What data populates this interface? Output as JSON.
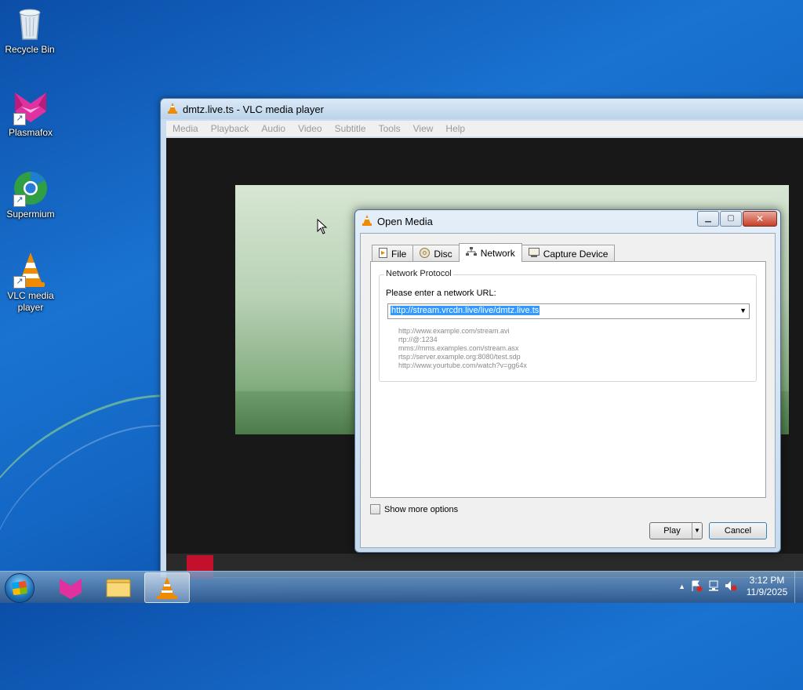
{
  "desktop": {
    "icons": [
      {
        "label": "Recycle Bin",
        "icon": "recycle-bin-icon"
      },
      {
        "label": "Plasmafox",
        "icon": "plasmafox-icon"
      },
      {
        "label": "Supermium",
        "icon": "supermium-icon"
      },
      {
        "label": "VLC media player",
        "icon": "vlc-icon"
      }
    ]
  },
  "vlc_window": {
    "title": "dmtz.live.ts - VLC media player",
    "menu": [
      "Media",
      "Playback",
      "Audio",
      "Video",
      "Subtitle",
      "Tools",
      "View",
      "Help"
    ]
  },
  "dialog": {
    "title": "Open Media",
    "tabs": [
      {
        "label": "File",
        "icon": "file-icon"
      },
      {
        "label": "Disc",
        "icon": "disc-icon"
      },
      {
        "label": "Network",
        "icon": "network-icon",
        "active": true
      },
      {
        "label": "Capture Device",
        "icon": "capture-device-icon"
      }
    ],
    "group_title": "Network Protocol",
    "url_prompt": "Please enter a network URL:",
    "url_value": "http://stream.vrcdn.live/live/dmtz.live.ts",
    "examples": [
      "http://www.example.com/stream.avi",
      "rtp://@:1234",
      "mms://mms.examples.com/stream.asx",
      "rtsp://server.example.org:8080/test.sdp",
      "http://www.yourtube.com/watch?v=gg64x"
    ],
    "show_more_options": "Show more options",
    "show_more_checked": false,
    "play_label": "Play",
    "cancel_label": "Cancel"
  },
  "taskbar": {
    "time": "3:12 PM",
    "date": "11/9/2025"
  },
  "colors": {
    "selection": "#3399ff",
    "vlc_orange": "#f08a00"
  }
}
